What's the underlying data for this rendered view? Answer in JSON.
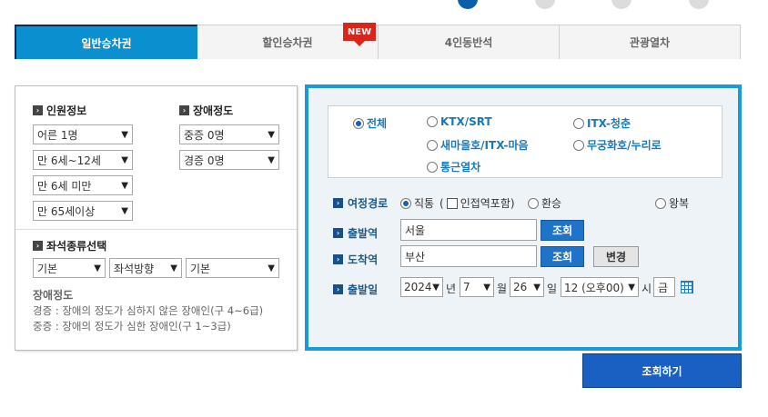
{
  "tabs": [
    {
      "label": "일반승차권",
      "active": true
    },
    {
      "label": "할인승차권",
      "badge": "NEW"
    },
    {
      "label": "4인동반석"
    },
    {
      "label": "관광열차"
    }
  ],
  "passenger": {
    "title": "인원정보",
    "selects": [
      "어른 1명",
      "만 6세~12세",
      "만 6세 미만",
      "만 65세이상"
    ]
  },
  "disability": {
    "title": "장애정도",
    "selects": [
      "중증 0명",
      "경증 0명"
    ]
  },
  "seat": {
    "title": "좌석종류선택",
    "selects": [
      "기본",
      "좌석방향",
      "기본"
    ]
  },
  "note": {
    "title": "장애정도",
    "lines": [
      "경증 : 장애의 정도가 심하지 않은 장애인(구 4~6급)",
      "중증 : 장애의 정도가 심한 장애인(구 1~3급)"
    ]
  },
  "train_types": [
    {
      "label": "전체",
      "checked": true
    },
    {
      "label": "KTX/SRT",
      "checked": false
    },
    {
      "label": "ITX-청춘",
      "checked": false
    },
    {
      "label": "새마을호/ITX-마음",
      "checked": false
    },
    {
      "label": "무궁화호/누리로",
      "checked": false
    },
    {
      "label": "통근열차",
      "checked": false
    }
  ],
  "route": {
    "label": "여정경로",
    "direct": "직통",
    "transfer_parens": "(",
    "nearby": "인접역포함)",
    "transfer": "환승",
    "roundtrip": "왕복"
  },
  "departure": {
    "label": "출발역",
    "value": "서울",
    "button": "조회"
  },
  "arrival": {
    "label": "도착역",
    "value": "부산",
    "button": "조회",
    "swap": "변경"
  },
  "date": {
    "label": "출발일",
    "year": "2024",
    "year_unit": "년",
    "month": "7",
    "month_unit": "월",
    "day": "26",
    "day_unit": "일",
    "hour": "12 (오후00)",
    "hour_unit": "시",
    "weekday": "금"
  },
  "search_button": "조회하기",
  "colors": {
    "accent": "#1a9ad6",
    "tab_active": "#0b8fcf",
    "button_blue": "#1a5fc2",
    "badge_red": "#d9261c"
  }
}
